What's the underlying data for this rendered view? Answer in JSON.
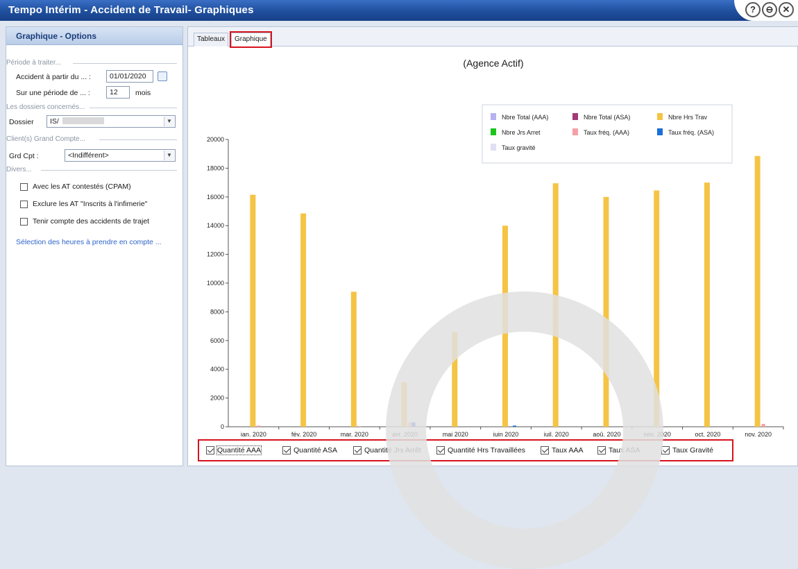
{
  "window": {
    "title": "Tempo Intérim - Accident de Travail- Graphiques"
  },
  "window_buttons": {
    "help": "?",
    "restore": "⊖",
    "close": "✕"
  },
  "left_panel": {
    "title": "Graphique - Options",
    "periode_group": "Période à traiter...",
    "accident_label": "Accident à partir du ... :",
    "accident_value": "01/01/2020",
    "periode_label": "Sur une période de ... :",
    "periode_value": "12",
    "periode_unit": "mois",
    "dossiers_group": "Les dossiers concernés...",
    "dossier_label": "Dossier",
    "dossier_value": "IS/",
    "clients_group": "Client(s) Grand Compte...",
    "grdcpt_label": "Grd Cpt :",
    "grdcpt_value": "<Indifférent>",
    "divers_group": "Divers...",
    "checkboxes": [
      "Avec les AT contestés (CPAM)",
      "Exclure les AT \"Inscrits à l'infimerie\"",
      "Tenir compte des accidents de trajet"
    ],
    "link": "Sélection des heures à prendre en compte ..."
  },
  "tabs": [
    "Tableaux",
    "Graphique"
  ],
  "legend": [
    {
      "label": "Nbre Total (AAA)",
      "color": "#b7b2ee"
    },
    {
      "label": "Nbre Total (ASA)",
      "color": "#a23a78"
    },
    {
      "label": "Nbre Hrs Trav",
      "color": "#f5c445"
    },
    {
      "label": "Nbre Jrs Arret",
      "color": "#1ec41e"
    },
    {
      "label": "Taux fréq. (AAA)",
      "color": "#f5a0a8"
    },
    {
      "label": "Taux fréq. (ASA)",
      "color": "#1a6fd8"
    },
    {
      "label": "Taux gravité",
      "color": "#e0e0f4"
    }
  ],
  "chart_data": {
    "type": "bar",
    "title": "(Agence Actif)",
    "categories": [
      "janv. 2020",
      "févr. 2020",
      "mars 2020",
      "avr. 2020",
      "mai 2020",
      "juin 2020",
      "juil. 2020",
      "août 2020",
      "sept. 2020",
      "oct. 2020",
      "nov. 2020"
    ],
    "category_labels": [
      "jan. 2020",
      "fév. 2020",
      "mar. 2020",
      "avr. 2020",
      "mai 2020",
      "juin 2020",
      "juil. 2020",
      "aoû. 2020",
      "sep. 2020",
      "oct. 2020",
      "nov. 2020"
    ],
    "yticks": [
      0,
      2000,
      4000,
      6000,
      8000,
      10000,
      12000,
      14000,
      16000,
      18000,
      20000
    ],
    "ylim": [
      0,
      20000
    ],
    "grid": false,
    "legend_position": "top-right",
    "series": [
      {
        "name": "Nbre Total (AAA)",
        "values": [
          0,
          0,
          0,
          0,
          0,
          0,
          0,
          0,
          0,
          0,
          0
        ]
      },
      {
        "name": "Nbre Total (ASA)",
        "values": [
          0,
          0,
          0,
          0,
          0,
          0,
          0,
          0,
          0,
          0,
          0
        ]
      },
      {
        "name": "Nbre Hrs Trav",
        "values": [
          16150,
          14850,
          9400,
          3100,
          6600,
          14000,
          16950,
          16000,
          16450,
          17000,
          18850
        ]
      },
      {
        "name": "Nbre Jrs Arret",
        "values": [
          0,
          0,
          0,
          0,
          0,
          0,
          0,
          0,
          0,
          0,
          0
        ]
      },
      {
        "name": "Taux fréq. (AAA)",
        "values": [
          80,
          0,
          40,
          300,
          0,
          0,
          0,
          0,
          0,
          0,
          200
        ]
      },
      {
        "name": "Taux fréq. (ASA)",
        "values": [
          0,
          0,
          0,
          300,
          0,
          80,
          0,
          0,
          0,
          0,
          0
        ]
      },
      {
        "name": "Taux gravité",
        "values": [
          0,
          0,
          0,
          0,
          0,
          0,
          0,
          0,
          0,
          0,
          0
        ]
      }
    ]
  },
  "bottom_checks": [
    "Quantité AAA",
    "Quantité ASA",
    "Quantité Jrs Arrêt",
    "Quantité Hrs Travaillées",
    "Taux AAA",
    "Taux ASA",
    "Taux Gravité"
  ]
}
